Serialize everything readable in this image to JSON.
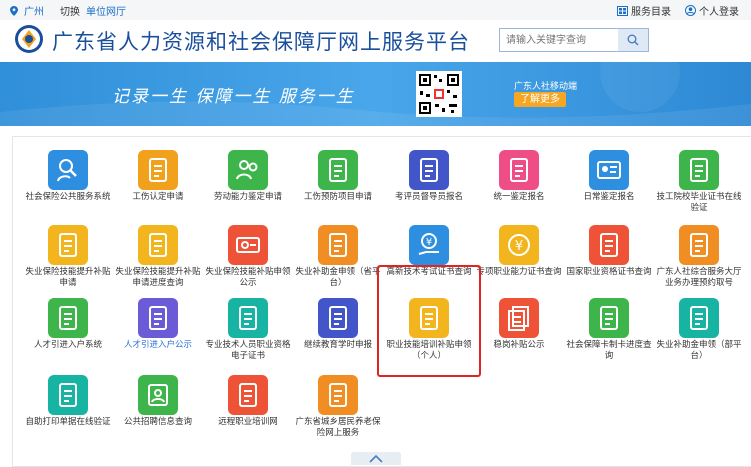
{
  "topbar": {
    "city": "广州",
    "switch_label": "切换",
    "unit_label": "单位网厅",
    "catalog_label": "服务目录",
    "login_label": "个人登录"
  },
  "header": {
    "title": "广东省人力资源和社会保障厅网上服务平台",
    "search_placeholder": "请输入关键字查询"
  },
  "banner": {
    "slogan": "记录一生  保障一生  服务一生",
    "mobile_title": "广东人社移动端",
    "more_label": "了解更多"
  },
  "colors": {
    "teal": "#17b3a3",
    "green": "#3db54a",
    "orange": "#f08d23",
    "yellow": "#f2b51d",
    "blue": "#2e8fe0",
    "purple": "#6b5bd6",
    "pink": "#ef4d86",
    "red": "#ee5338",
    "indigo": "#4356c9"
  },
  "tiles": [
    {
      "label": "社会保险公共服务系统",
      "color": "#2e8fe0",
      "icon": "person-search-icon",
      "interactive": true
    },
    {
      "label": "工伤认定申请",
      "color": "#f2a11d",
      "icon": "document-add-icon",
      "interactive": true
    },
    {
      "label": "劳动能力鉴定申请",
      "color": "#3db54a",
      "icon": "people-icon",
      "interactive": true
    },
    {
      "label": "工伤预防项目申请",
      "color": "#3db54a",
      "icon": "list-document-icon",
      "interactive": true
    },
    {
      "label": "考评员督导员报名",
      "color": "#4356c9",
      "icon": "person-badge-icon",
      "interactive": true
    },
    {
      "label": "统一鉴定报名",
      "color": "#ef4d86",
      "icon": "document-check-icon",
      "interactive": true
    },
    {
      "label": "日常鉴定报名",
      "color": "#2e8fe0",
      "icon": "id-card-icon",
      "interactive": true
    },
    {
      "label": "技工院校毕业证书在线验证",
      "color": "#3db54a",
      "icon": "certificate-icon",
      "interactive": true
    },
    {
      "label": "失业保险技能提升补贴申请",
      "color": "#f2b51d",
      "icon": "checklist-icon",
      "interactive": true
    },
    {
      "label": "失业保险技能提升补贴申请进度查询",
      "color": "#f2b51d",
      "icon": "progress-document-icon",
      "interactive": true
    },
    {
      "label": "失业保险技能补贴申领公示",
      "color": "#ee5338",
      "icon": "card-icon",
      "interactive": true
    },
    {
      "label": "失业补助金申领（省平台）",
      "color": "#f08d23",
      "icon": "money-document-icon",
      "interactive": true
    },
    {
      "label": "高新技术考试证书查询",
      "color": "#2e8fe0",
      "icon": "yuan-hand-icon",
      "interactive": true
    },
    {
      "label": "专项职业能力证书查询",
      "color": "#f2b51d",
      "icon": "yuan-circle-icon",
      "interactive": true
    },
    {
      "label": "国家职业资格证书查询",
      "color": "#ee5338",
      "icon": "certificate-icon",
      "interactive": true
    },
    {
      "label": "广东人社综合服务大厅业务办理预约取号",
      "color": "#f08d23",
      "icon": "form-icon",
      "interactive": true
    },
    {
      "label": "人才引进入户系统",
      "color": "#3db54a",
      "icon": "search-document-icon",
      "interactive": true
    },
    {
      "label": "人才引进入户公示",
      "color": "#6b5bd6",
      "icon": "wallet-icon",
      "interactive": true,
      "blue": true
    },
    {
      "label": "专业技术人员职业资格电子证书",
      "color": "#17b3a3",
      "icon": "certificate-search-icon",
      "interactive": true
    },
    {
      "label": "继续教育学时申报",
      "color": "#4356c9",
      "icon": "person-document-icon",
      "interactive": true
    },
    {
      "label": "职业技能培训补贴申领（个人）",
      "color": "#f2b51d",
      "icon": "edit-document-icon",
      "interactive": true
    },
    {
      "label": "稳岗补贴公示",
      "color": "#ee5338",
      "icon": "stack-documents-icon",
      "interactive": true
    },
    {
      "label": "社会保障卡制卡进度查询",
      "color": "#3db54a",
      "icon": "search-document-icon",
      "interactive": true
    },
    {
      "label": "失业补助金申领（部平台）",
      "color": "#17b3a3",
      "icon": "yuan-document-icon",
      "interactive": true
    },
    {
      "label": "自助打印单据在线验证",
      "color": "#17b3a3",
      "icon": "print-check-icon",
      "interactive": true
    },
    {
      "label": "公共招聘信息查询",
      "color": "#3db54a",
      "icon": "recruit-icon",
      "interactive": true
    },
    {
      "label": "远程职业培训网",
      "color": "#ee5338",
      "icon": "remote-training-icon",
      "interactive": true
    },
    {
      "label": "广东省城乡居民养老保险网上服务",
      "color": "#f08d23",
      "icon": "person-doc-icon",
      "interactive": true
    }
  ]
}
